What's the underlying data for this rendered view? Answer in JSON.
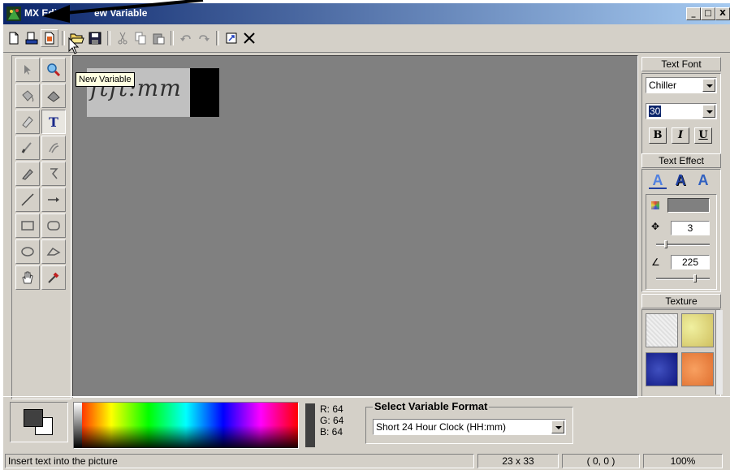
{
  "window": {
    "title_visible": "MX Editor",
    "title_rest": "ew Variable",
    "minimize": "_",
    "maximize": "□",
    "close": "X"
  },
  "toolbar": {
    "buttons": [
      "new-document-icon",
      "print-icon",
      "new-variable-icon",
      "open-folder-icon",
      "save-icon",
      "cut-icon",
      "copy-icon",
      "paste-icon",
      "undo-icon",
      "redo-icon",
      "resize-icon",
      "delete-icon"
    ]
  },
  "tooltip": "New Variable",
  "canvas": {
    "variable_text": "ftft:mm"
  },
  "tools": [
    "arrow-tool",
    "magnifier-tool",
    "fill-bucket-tool",
    "eraser-shape-tool",
    "eraser-tool",
    "text-tool",
    "brush-tool",
    "spray-tool",
    "pen-tool",
    "lasso-tool",
    "line-tool",
    "arrow-line-tool",
    "rectangle-tool",
    "rounded-rect-tool",
    "ellipse-tool",
    "polygon-tool",
    "hand-tool",
    "color-picker-tool"
  ],
  "text_font": {
    "title": "Text Font",
    "font": "Chiller",
    "size": "30",
    "bold": "B",
    "italic": "I",
    "underline": "U"
  },
  "text_effect": {
    "title": "Text Effect",
    "letter": "A",
    "shadow_distance": "3",
    "shadow_angle": "225"
  },
  "texture": {
    "title": "Texture"
  },
  "color": {
    "r_label": "R: 64",
    "g_label": "G: 64",
    "b_label": "B: 64",
    "current": "#404040"
  },
  "variable_format": {
    "legend": "Select Variable Format",
    "selected": "Short 24 Hour Clock (HH:mm)"
  },
  "status": {
    "hint": "Insert text into the picture",
    "size": "23 x 33",
    "position": "( 0, 0 )",
    "zoom": "100%"
  }
}
